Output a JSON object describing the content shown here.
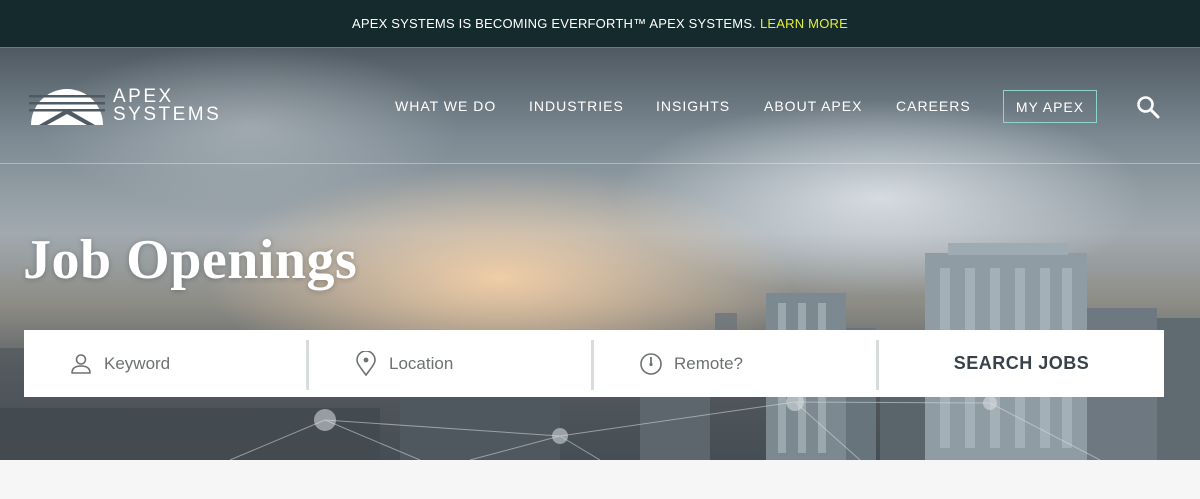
{
  "announcement": {
    "text": "APEX SYSTEMS IS BECOMING EVERFORTH™ APEX SYSTEMS.",
    "link_label": "LEARN MORE",
    "link_color": "#e3ee3a",
    "background": "#152a2c"
  },
  "logo": {
    "line1": "APEX",
    "line2": "SYSTEMS"
  },
  "nav": {
    "items": [
      {
        "label": "WHAT WE DO"
      },
      {
        "label": "INDUSTRIES"
      },
      {
        "label": "INSIGHTS"
      },
      {
        "label": "ABOUT APEX"
      },
      {
        "label": "CAREERS"
      }
    ],
    "my_apex_label": "MY APEX",
    "my_apex_border_color": "#8fd3cf",
    "search_icon": "magnifier-icon"
  },
  "hero": {
    "title": "Job Openings"
  },
  "search": {
    "keyword_placeholder": "Keyword",
    "keyword_icon": "person-icon",
    "location_placeholder": "Location",
    "location_icon": "map-pin-icon",
    "remote_placeholder": "Remote?",
    "remote_icon": "clock-icon",
    "submit_label": "SEARCH JOBS"
  }
}
